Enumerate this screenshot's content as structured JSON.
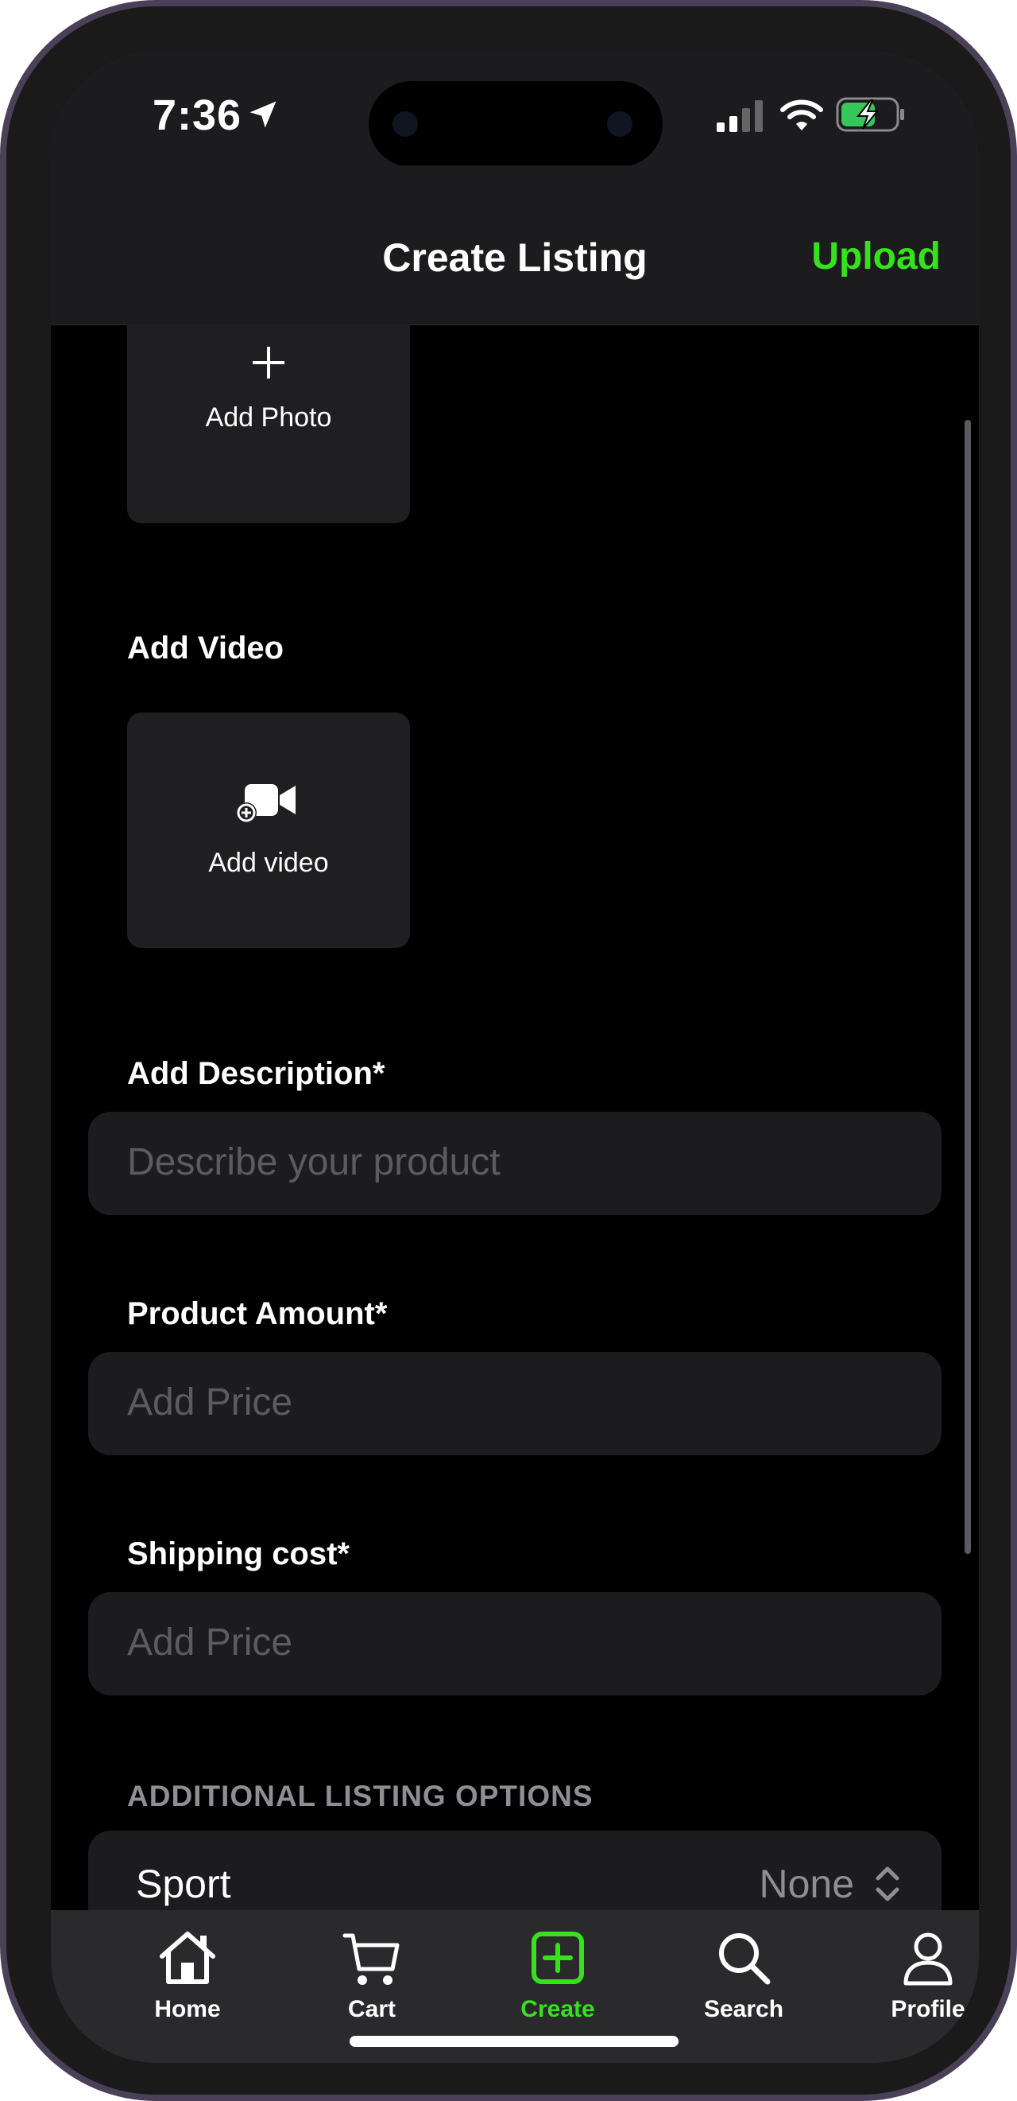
{
  "status_bar": {
    "time": "7:36"
  },
  "nav": {
    "title": "Create Listing",
    "upload_label": "Upload"
  },
  "photo_tile": {
    "label": "Add Photo",
    "icon": "plus-icon"
  },
  "video_section": {
    "heading": "Add Video",
    "tile_label": "Add video",
    "icon": "video-camera-plus-icon"
  },
  "description": {
    "heading": "Add Description*",
    "placeholder": "Describe your product"
  },
  "product_amount": {
    "heading": "Product Amount*",
    "placeholder": "Add Price"
  },
  "shipping": {
    "heading": "Shipping cost*",
    "placeholder": "Add Price"
  },
  "additional_options": {
    "header": "ADDITIONAL LISTING OPTIONS",
    "sport": {
      "label": "Sport",
      "value": "None"
    }
  },
  "tab_bar": {
    "tabs": [
      {
        "label": "Home",
        "icon": "home-icon"
      },
      {
        "label": "Cart",
        "icon": "cart-icon"
      },
      {
        "label": "Create",
        "icon": "create-plus-square-icon"
      },
      {
        "label": "Search",
        "icon": "search-icon"
      },
      {
        "label": "Profile",
        "icon": "person-icon"
      }
    ],
    "active_index": 2
  },
  "colors": {
    "accent": "#35e21c",
    "background": "#000000",
    "surface": "#1c1c1e",
    "placeholder": "#5c5c60",
    "secondary_text": "#8e8e93",
    "frame": "#4a4158"
  }
}
